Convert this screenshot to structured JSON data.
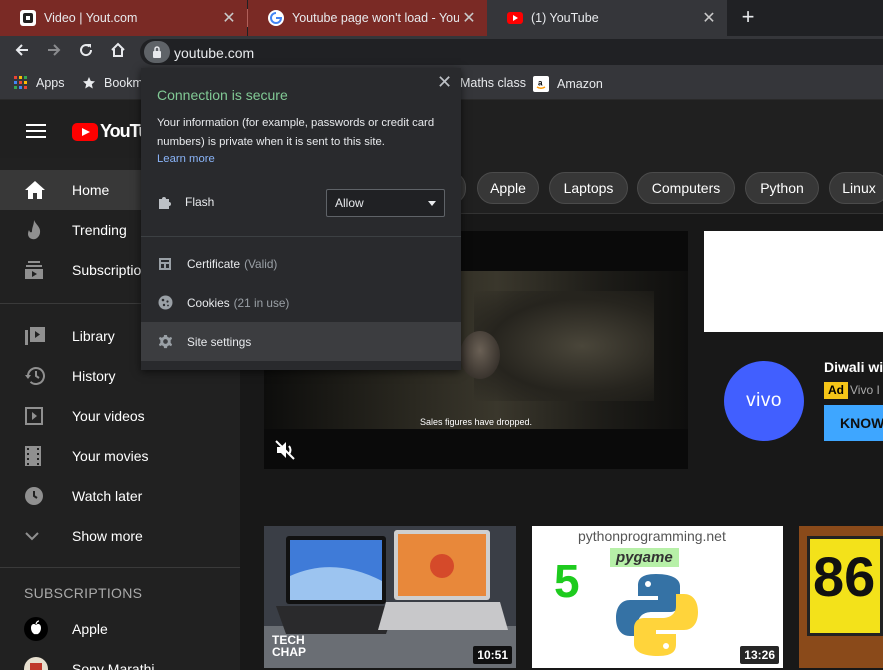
{
  "browser": {
    "tabs": [
      {
        "title": "Video | Yout.com"
      },
      {
        "title": "Youtube page won't load - YouTube"
      },
      {
        "title": "(1) YouTube"
      }
    ],
    "url": "youtube.com",
    "bookmarks": [
      {
        "label": "Apps"
      },
      {
        "label": "Bookm"
      },
      {
        "label": "Maths class"
      },
      {
        "label": "Amazon"
      }
    ]
  },
  "security_popup": {
    "heading": "Connection is secure",
    "body": "Your information (for example, passwords or credit card numbers) is private when it is sent to this site.",
    "learn_more": "Learn more",
    "flash_label": "Flash",
    "flash_value": "Allow",
    "certificate_label": "Certificate",
    "certificate_status": "(Valid)",
    "cookies_label": "Cookies",
    "cookies_status": "(21 in use)",
    "site_settings_label": "Site settings"
  },
  "youtube": {
    "logo_text": "YouTube",
    "sidebar": {
      "items": [
        {
          "label": "Home"
        },
        {
          "label": "Trending"
        },
        {
          "label": "Subscriptions"
        },
        {
          "label": "Library"
        },
        {
          "label": "History"
        },
        {
          "label": "Your videos"
        },
        {
          "label": "Your movies"
        },
        {
          "label": "Watch later"
        },
        {
          "label": "Show more"
        }
      ],
      "subscriptions_heading": "SUBSCRIPTIONS",
      "subscriptions": [
        {
          "label": "Apple"
        },
        {
          "label": "Sony Marathi"
        }
      ]
    },
    "chips": [
      "Apple",
      "Laptops",
      "Computers",
      "Python",
      "Linux"
    ],
    "video": {
      "caption": "Sales figures have dropped."
    },
    "ad": {
      "brand": "vivo",
      "title": "Diwali wit",
      "badge": "Ad",
      "advertiser": "Vivo I",
      "cta": "KNOW"
    },
    "thumbnails": [
      {
        "overlay": "TECH CHAP",
        "duration": "10:51"
      },
      {
        "header": "pythonprogramming.net",
        "number": "5",
        "tag": "pygame",
        "duration": "13:26"
      },
      {
        "number": "86"
      }
    ]
  },
  "colors": {
    "youtube_red": "#ff0000",
    "secure_green": "#81c995",
    "link_blue": "#8ab4f8",
    "vivo_blue": "#415fff",
    "ad_yellow": "#f5c518",
    "cta_blue": "#3ea6ff"
  }
}
